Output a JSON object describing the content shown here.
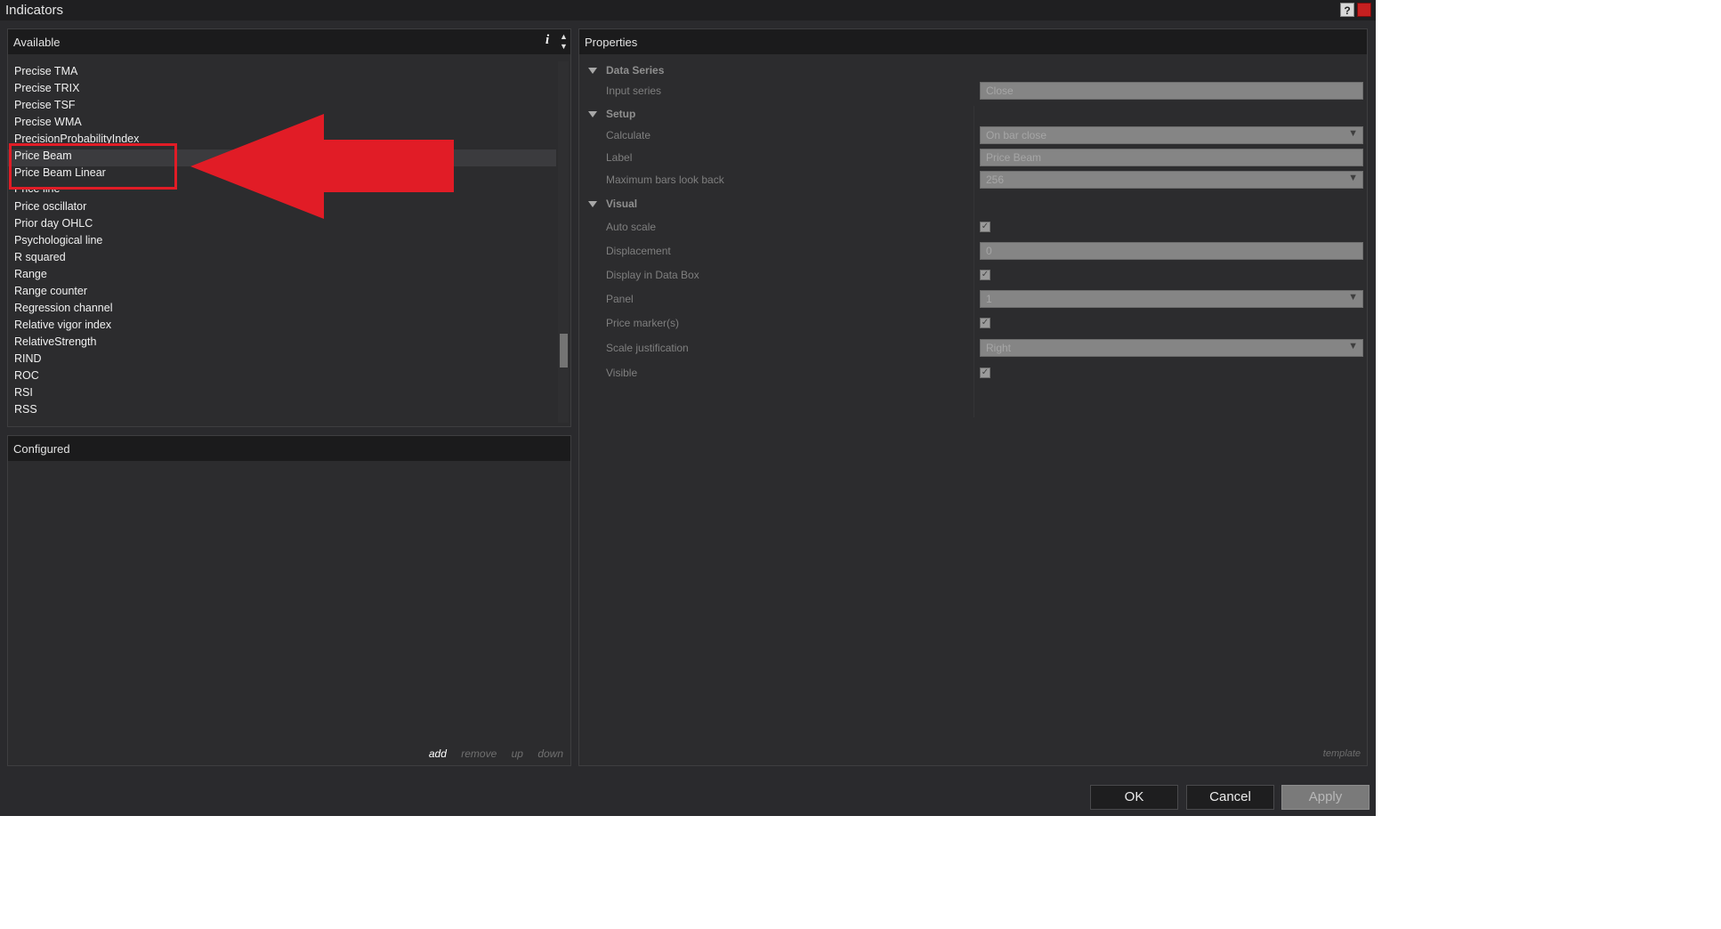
{
  "window": {
    "title": "Indicators",
    "help_label": "?"
  },
  "available": {
    "header": "Available",
    "info_label": "i",
    "items": [
      "Precise TMA",
      "Precise TRIX",
      "Precise TSF",
      "Precise WMA",
      "PrecisionProbabilityIndex",
      "Price Beam",
      "Price Beam Linear",
      "Price line",
      "Price oscillator",
      "Prior day OHLC",
      "Psychological line",
      "R squared",
      "Range",
      "Range counter",
      "Regression channel",
      "Relative vigor index",
      "RelativeStrength",
      "RIND",
      "ROC",
      "RSI",
      "RSS"
    ],
    "selected_item": "Price Beam"
  },
  "configured": {
    "header": "Configured",
    "actions": {
      "add": "add",
      "remove": "remove",
      "up": "up",
      "down": "down"
    }
  },
  "properties": {
    "header": "Properties",
    "groups": {
      "data_series": "Data Series",
      "setup": "Setup",
      "visual": "Visual"
    },
    "rows": {
      "input_series": {
        "label": "Input series",
        "value": "Close"
      },
      "calculate": {
        "label": "Calculate",
        "value": "On bar close"
      },
      "label": {
        "label": "Label",
        "value": "Price Beam"
      },
      "max_bars": {
        "label": "Maximum bars look back",
        "value": "256"
      },
      "auto_scale": {
        "label": "Auto scale",
        "checked": true
      },
      "displacement": {
        "label": "Displacement",
        "value": "0"
      },
      "display_data_box": {
        "label": "Display in Data Box",
        "checked": true
      },
      "panel": {
        "label": "Panel",
        "value": "1"
      },
      "price_markers": {
        "label": "Price marker(s)",
        "checked": true
      },
      "scale_justification": {
        "label": "Scale justification",
        "value": "Right"
      },
      "visible": {
        "label": "Visible",
        "checked": true
      }
    },
    "template_link": "template"
  },
  "buttons": {
    "ok": "OK",
    "cancel": "Cancel",
    "apply": "Apply"
  },
  "annotation": {
    "color": "#e11c26"
  }
}
